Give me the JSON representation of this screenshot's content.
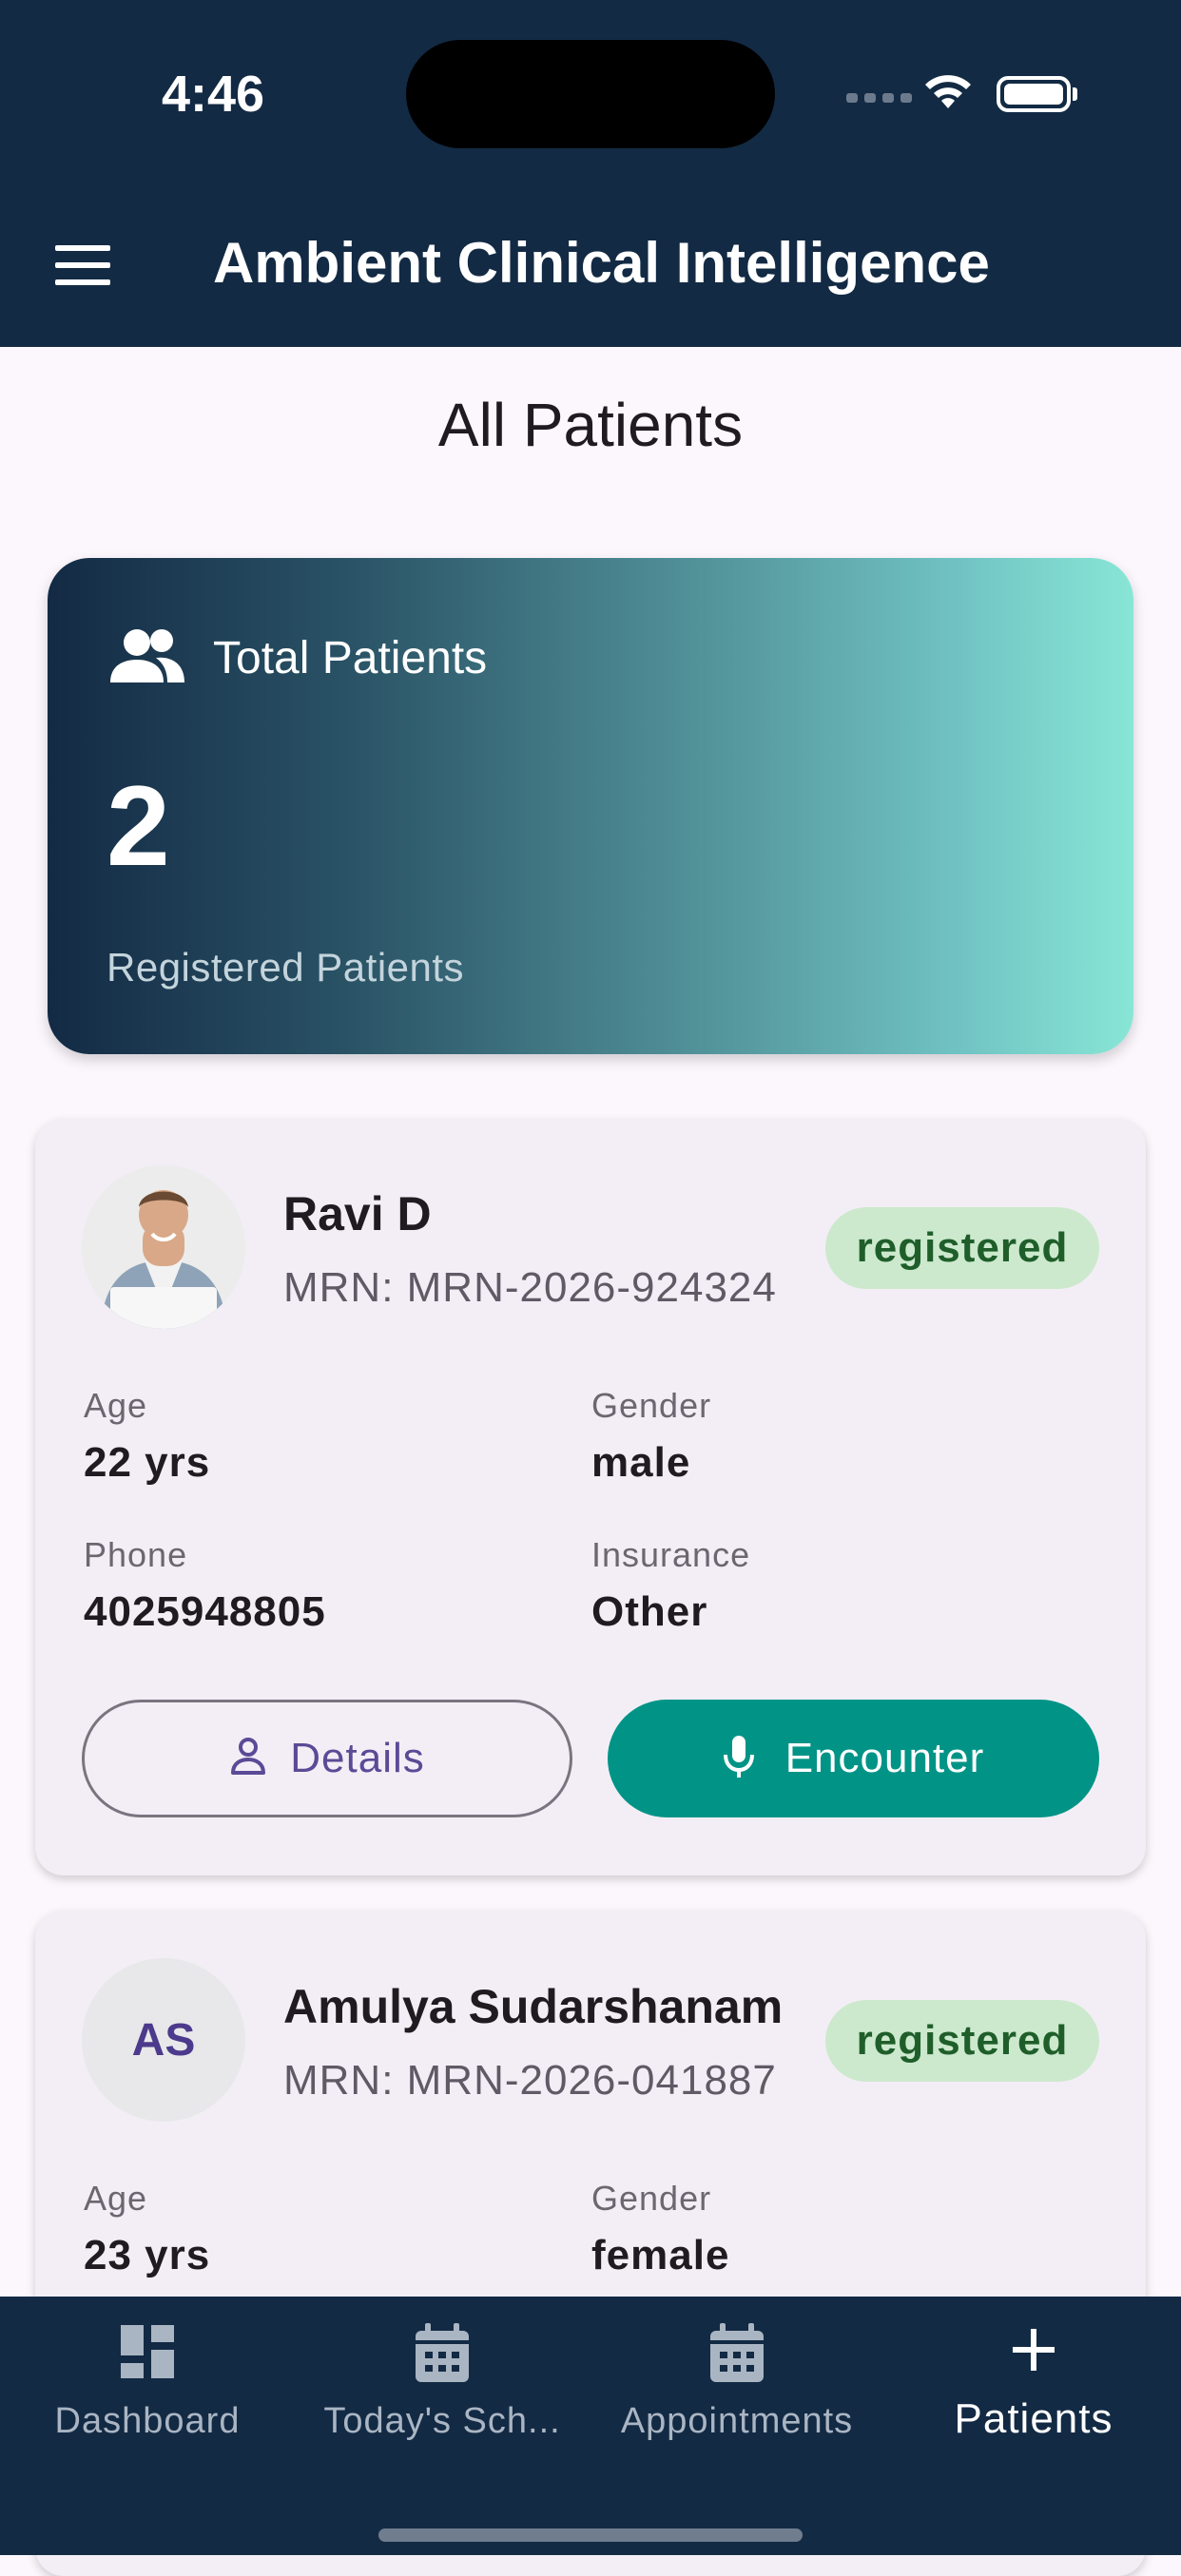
{
  "status_bar": {
    "time": "4:46"
  },
  "app_bar": {
    "title": "Ambient Clinical Intelligence",
    "menu_icon": "menu-icon"
  },
  "page": {
    "title": "All Patients"
  },
  "summary": {
    "label": "Total Patients",
    "count": "2",
    "subtitle": "Registered Patients",
    "icon": "people-icon"
  },
  "patients": [
    {
      "name": "Ravi D",
      "mrn": "MRN: MRN-2026-924324",
      "status": "registered",
      "avatar": "photo",
      "age_label": "Age",
      "age": "22 yrs",
      "gender_label": "Gender",
      "gender": "male",
      "phone_label": "Phone",
      "phone": "4025948805",
      "insurance_label": "Insurance",
      "insurance": "Other",
      "details_label": "Details",
      "encounter_label": "Encounter"
    },
    {
      "name": "Amulya Sudarshanam",
      "mrn": "MRN: MRN-2026-041887",
      "status": "registered",
      "initials": "AS",
      "age_label": "Age",
      "age": "23 yrs",
      "gender_label": "Gender",
      "gender": "female"
    }
  ],
  "bottom_nav": {
    "items": [
      {
        "label": "Dashboard",
        "icon": "dashboard-icon"
      },
      {
        "label": "Today's Sch...",
        "icon": "calendar-icon"
      },
      {
        "label": "Appointments",
        "icon": "calendar-icon"
      },
      {
        "label": "Patients",
        "icon": "plus-icon",
        "active": true
      }
    ]
  },
  "colors": {
    "app_bar": "#132a44",
    "accent_teal": "#019486",
    "badge_bg": "#cce9cd",
    "badge_text": "#1f5e2a",
    "background": "#fcf7fd"
  }
}
